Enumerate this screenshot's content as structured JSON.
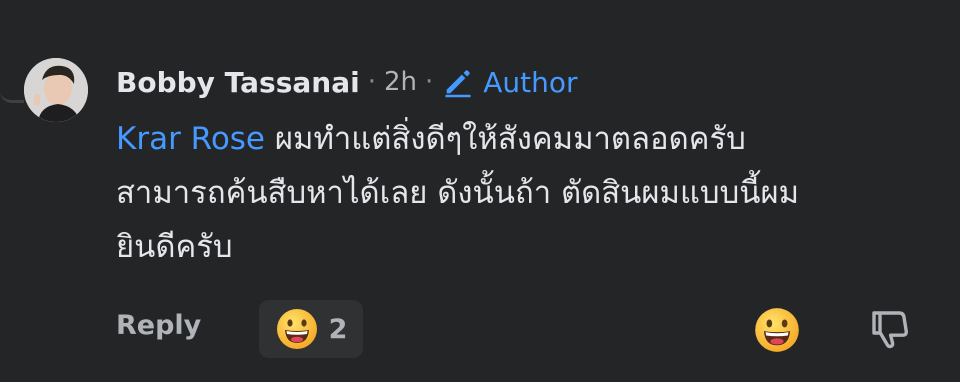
{
  "comment": {
    "author": "Bobby Tassanai",
    "separator": "·",
    "timestamp": "2h",
    "badge": "Author",
    "mention": "Krar Rose",
    "text_line1": " ผมทำแต่สิ่งดีๆให้สังคมมาตลอดครับ",
    "text_line2": "สามารถค้นสืบหาได้เลย ดังนั้นถ้า ตัดสินผมแบบนี้ผม",
    "text_line3": "ยินดีครับ"
  },
  "actions": {
    "reply_label": "Reply",
    "reaction_count": "2",
    "reaction_icon": "grinning-face-emoji",
    "react_icon": "grinning-face-emoji",
    "dislike_icon": "thumbs-down-outline-icon"
  },
  "colors": {
    "background": "#242526",
    "primary_text": "#e4e6eb",
    "secondary_text": "#b0b3b8",
    "accent_blue": "#4599ff",
    "pill_background": "#303133"
  }
}
